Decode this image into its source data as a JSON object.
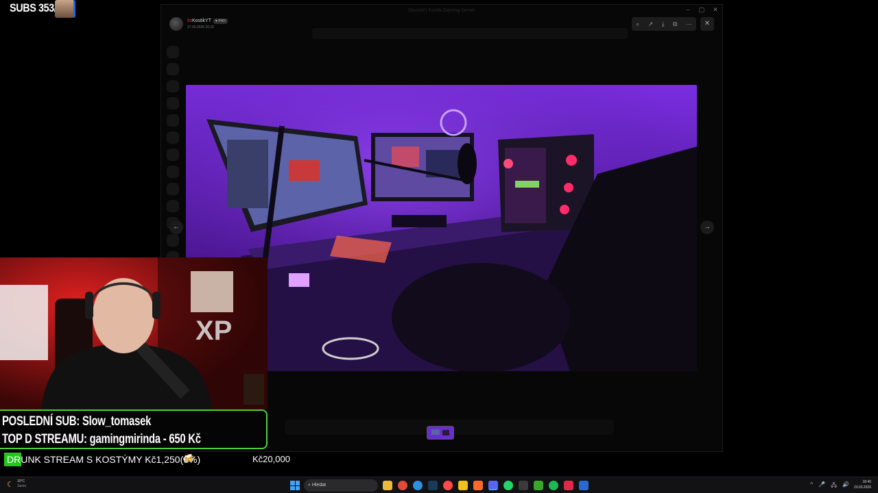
{
  "overlay": {
    "subs_label": "SUBS 353/"
  },
  "window": {
    "title": "Discord | Kostik Gaming Server",
    "controls": [
      "–",
      "▢",
      "✕"
    ],
    "author": {
      "name_prefix": "itz",
      "name_rest": "KostikYT",
      "badge": "♥ PHD",
      "date": "17.03.2026 20:22"
    },
    "toolbar_icons": [
      "zoom-icon",
      "share-icon",
      "download-icon",
      "open-external-icon",
      "more-icon"
    ],
    "toolbar_glyphs": [
      "⌕",
      "↗",
      "⤓",
      "⧉",
      "⋯"
    ],
    "close_glyph": "✕",
    "prev_glyph": "←",
    "next_glyph": "→"
  },
  "info": {
    "last_sub": "POSLEDNÍ SUB: Slow_tomasek",
    "top_donation": "TOP D STREAMU: gamingmirinda - 650 Kč"
  },
  "goal": {
    "text": "DRUNK STREAM S KOSTÝMY Kč1,250(6%)",
    "progress_percent": 6,
    "target": "Kč20,000",
    "icon": "🍻"
  },
  "taskbar": {
    "weather_temp": "10°C",
    "weather_desc": "Jasno",
    "search_placeholder": "Hledat",
    "time": "18:45",
    "date": "23.03.2026",
    "tray_glyphs": [
      "^",
      "🎤",
      "🖧",
      "🔊"
    ],
    "accent_color": "#3fa3ff"
  },
  "colors": {
    "goal_fill": "#22c71b",
    "info_border": "#4cd137",
    "photo_tint": "#6a1fc9"
  }
}
